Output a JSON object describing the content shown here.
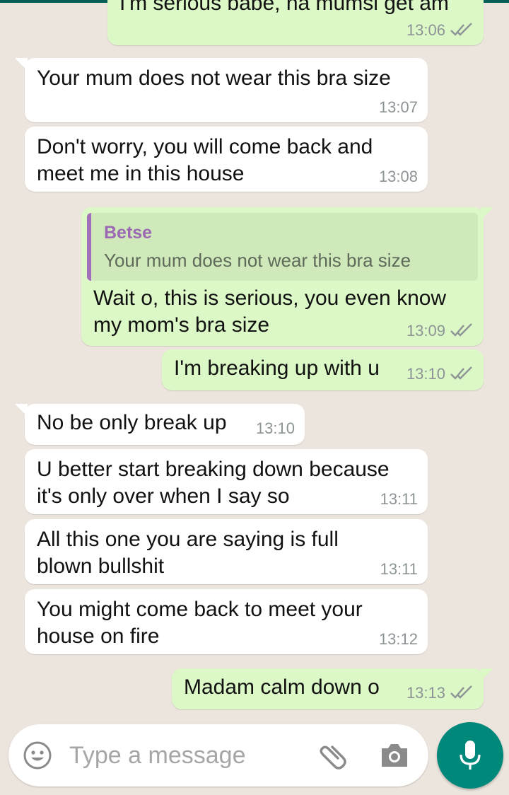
{
  "messages": [
    {
      "direction": "out",
      "text": "I'm serious babe, na mumsi get am",
      "time": "13:06",
      "status_icon": "double-check-icon"
    },
    {
      "direction": "in",
      "text": "Your mum does not wear this bra size",
      "time": "13:07"
    },
    {
      "direction": "in",
      "text": "Don't worry, you will come back and\nmeet me in this house",
      "time": "13:08"
    },
    {
      "direction": "out",
      "quote": {
        "author": "Betse",
        "text": "Your mum does not wear this bra size"
      },
      "text": "Wait o, this is serious, you even know\nmy mom's bra size",
      "time": "13:09",
      "status_icon": "double-check-icon"
    },
    {
      "direction": "out",
      "text": "I'm breaking up with u",
      "time": "13:10",
      "status_icon": "double-check-icon"
    },
    {
      "direction": "in",
      "text": "No be only break up",
      "time": "13:10"
    },
    {
      "direction": "in",
      "text": "U better start breaking down because\nit's only over when I say so",
      "time": "13:11"
    },
    {
      "direction": "in",
      "text": "All this one you are saying is full\nblown bullshit",
      "time": "13:11"
    },
    {
      "direction": "in",
      "text": "You might come back to meet your\nhouse on fire",
      "time": "13:12"
    },
    {
      "direction": "out",
      "text": "Madam calm down o",
      "time": "13:13",
      "status_icon": "double-check-icon"
    }
  ],
  "composer": {
    "placeholder": "Type a message",
    "icons": [
      "emoji-icon",
      "attach-icon",
      "camera-icon",
      "mic-icon"
    ]
  },
  "colors": {
    "background": "#ECE5DD",
    "incoming": "#FFFFFF",
    "outgoing": "#DCF8C6",
    "accent": "#00897B",
    "quote_author": "#9B68B3"
  }
}
